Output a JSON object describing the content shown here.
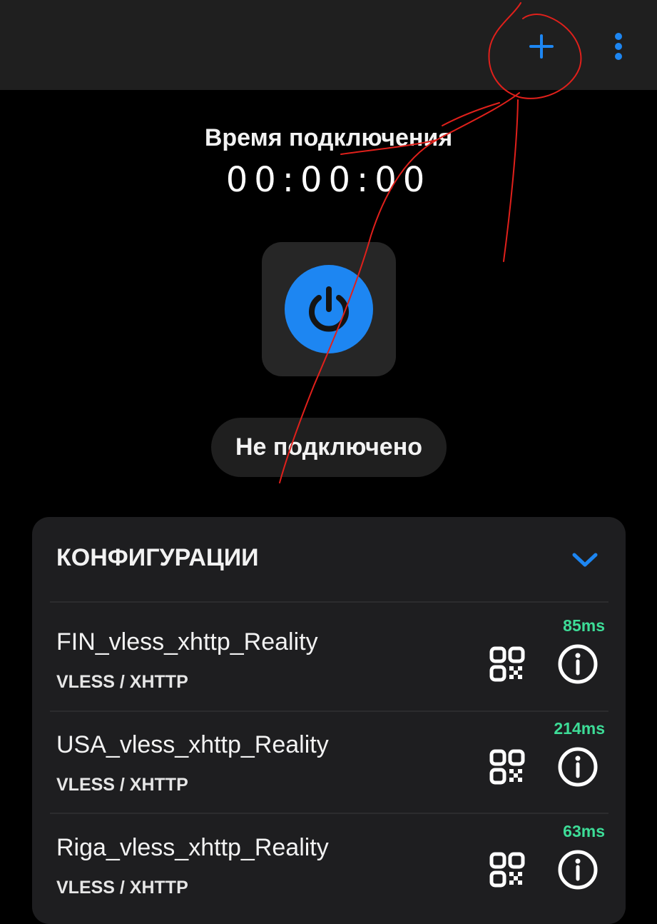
{
  "header": {
    "add_icon": "plus-icon",
    "menu_icon": "more-vertical-icon"
  },
  "timer": {
    "label": "Время подключения",
    "value": "00:00:00"
  },
  "power": {
    "icon": "power-icon",
    "color": "#1d86f2"
  },
  "status": {
    "text": "Не подключено"
  },
  "configs": {
    "title": "КОНФИГУРАЦИИ",
    "collapse_icon": "chevron-down-icon",
    "items": [
      {
        "name": "FIN_vless_xhttp_Reality",
        "protocol": "VLESS / XHTTP",
        "ping": "85ms"
      },
      {
        "name": "USA_vless_xhttp_Reality",
        "protocol": "VLESS / XHTTP",
        "ping": "214ms"
      },
      {
        "name": "Riga_vless_xhttp_Reality",
        "protocol": "VLESS / XHTTP",
        "ping": "63ms"
      }
    ]
  },
  "colors": {
    "accent": "#1d86f2",
    "ping": "#3ddc97",
    "annotation": "#e0201b"
  }
}
